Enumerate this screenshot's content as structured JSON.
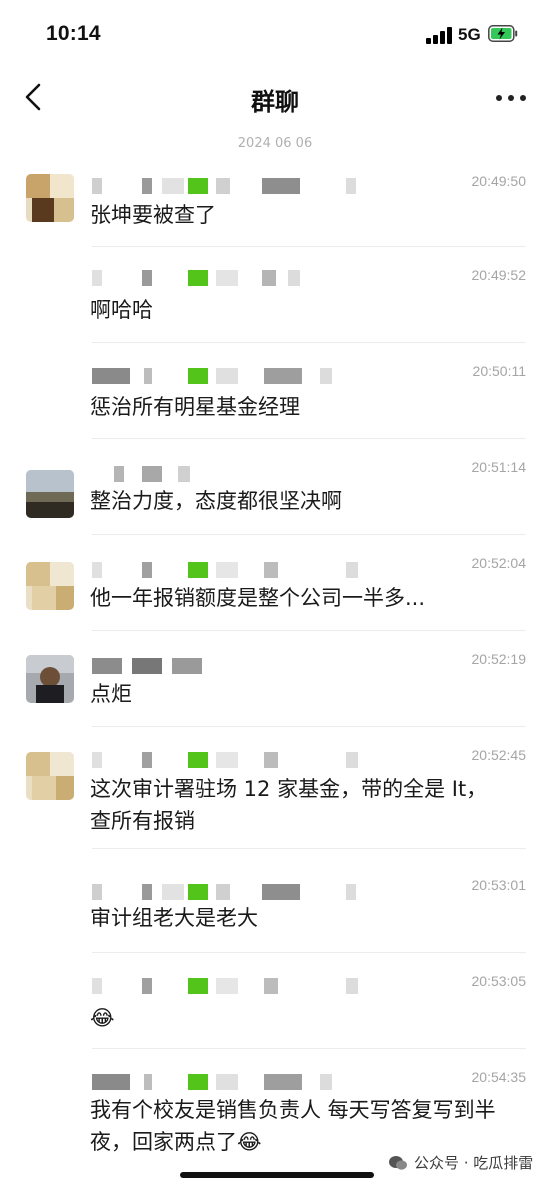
{
  "status_bar": {
    "time": "10:14",
    "network": "5G"
  },
  "nav": {
    "title": "群聊"
  },
  "date_divider": "2024 06 06",
  "messages": [
    {
      "time": "20:49:50",
      "text": "张坤要被查了"
    },
    {
      "time": "20:49:52",
      "text": "啊哈哈"
    },
    {
      "time": "20:50:11",
      "text": "惩治所有明星基金经理"
    },
    {
      "time": "20:51:14",
      "text": "整治力度，态度都很坚决啊"
    },
    {
      "time": "20:52:04",
      "text": "他一年报销额度是整个公司一半多..."
    },
    {
      "time": "20:52:19",
      "text": "点炬"
    },
    {
      "time": "20:52:45",
      "text": "这次审计署驻场 12 家基金，带的全是 It，查所有报销"
    },
    {
      "time": "20:53:01",
      "text": "审计组老大是老大"
    },
    {
      "time": "20:53:05",
      "text": "😂"
    },
    {
      "time": "20:54:35",
      "text": "我有个校友是销售负责人 每天写答复写到半夜，回家两点了😂"
    }
  ],
  "watermark": {
    "text": "公众号 · 吃瓜排雷"
  },
  "colors": {
    "accent_green": "#52c41a",
    "bg": "#ffffff"
  }
}
